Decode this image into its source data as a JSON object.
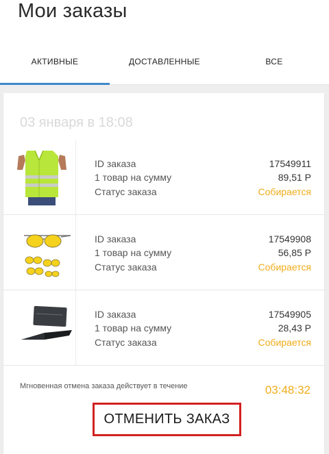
{
  "header": {
    "title": "Мои заказы"
  },
  "tabs": [
    {
      "label": "АКТИВНЫЕ",
      "active": true
    },
    {
      "label": "ДОСТАВЛЕННЫЕ",
      "active": false
    },
    {
      "label": "ВСЕ",
      "active": false
    }
  ],
  "order": {
    "date": "03 января в 18:08",
    "items": [
      {
        "image": "safety-vest-image",
        "id_label": "ID заказа",
        "id": "17549911",
        "sum_label": "1 товар на сумму",
        "sum": "89,51 Р",
        "status_label": "Статус заказа",
        "status": "Собирается"
      },
      {
        "image": "sunglasses-image",
        "id_label": "ID заказа",
        "id": "17549908",
        "sum_label": "1 товар на сумму",
        "sum": "56,85 Р",
        "status_label": "Статус заказа",
        "status": "Собирается"
      },
      {
        "image": "card-knife-image",
        "id_label": "ID заказа",
        "id": "17549905",
        "sum_label": "1 товар на сумму",
        "sum": "28,43 Р",
        "status_label": "Статус заказа",
        "status": "Собирается"
      }
    ],
    "cancel_note": "Мгновенная отмена заказа действует в течение",
    "timer": "03:48:32",
    "cancel_button": "ОТМЕНИТЬ ЗАКАЗ"
  },
  "colors": {
    "accent": "#3d87c8",
    "status": "#f0ac1a",
    "highlight": "#d32020"
  }
}
